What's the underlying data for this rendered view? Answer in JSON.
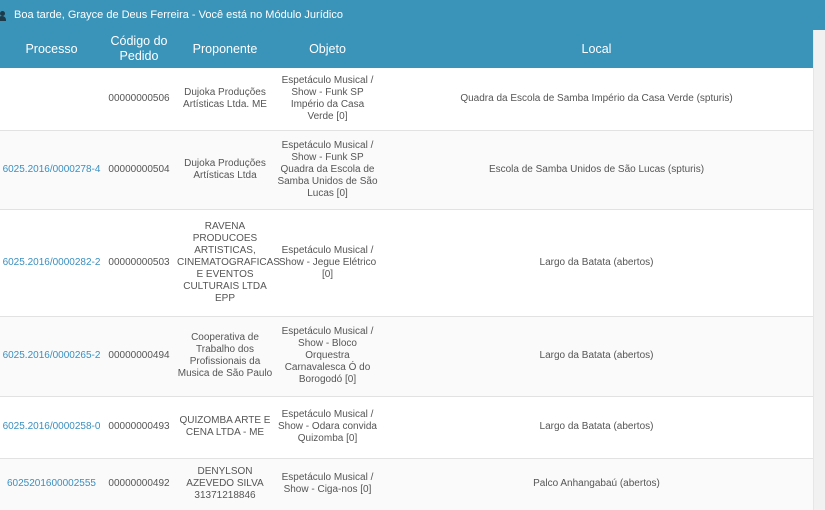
{
  "header": {
    "greeting": "Boa tarde, Grayce de Deus Ferreira - Você está no Módulo Jurídico"
  },
  "table": {
    "columns": [
      "Processo",
      "Código do Pedido",
      "Proponente",
      "Objeto",
      "Local"
    ],
    "rows": [
      {
        "processo": "",
        "codigo": "00000000506",
        "proponente": "Dujoka Produções Artísticas Ltda. ME",
        "objeto": "Espetáculo Musical / Show - Funk SP Império da Casa Verde [0]",
        "local": "Quadra da Escola de Samba Império da Casa Verde (spturis)"
      },
      {
        "processo": "6025.2016/0000278-4",
        "codigo": "00000000504",
        "proponente": "Dujoka Produções Artísticas Ltda",
        "objeto": "Espetáculo Musical / Show - Funk SP Quadra da Escola de Samba Unidos de São Lucas [0]",
        "local": "Escola de Samba Unidos de São Lucas (spturis)"
      },
      {
        "processo": "6025.2016/0000282-2",
        "codigo": "00000000503",
        "proponente": "RAVENA PRODUCOES ARTISTICAS, CINEMATOGRAFICAS E EVENTOS CULTURAIS LTDA EPP",
        "objeto": "Espetáculo Musical / Show - Jegue Elétrico [0]",
        "local": "Largo da Batata (abertos)"
      },
      {
        "processo": "6025.2016/0000265-2",
        "codigo": "00000000494",
        "proponente": "Cooperativa de Trabalho dos Profissionais da Musica de São Paulo",
        "objeto": "Espetáculo Musical / Show - Bloco Orquestra Carnavalesca Ó do Borogodó [0]",
        "local": "Largo da Batata (abertos)"
      },
      {
        "processo": "6025.2016/0000258-0",
        "codigo": "00000000493",
        "proponente": "QUIZOMBA ARTE E CENA LTDA - ME",
        "objeto": "Espetáculo Musical / Show - Odara convida Quizomba [0]",
        "local": "Largo da Batata (abertos)"
      },
      {
        "processo": "6025201600002555",
        "codigo": "00000000492",
        "proponente": "DENYLSON AZEVEDO SILVA 31371218846",
        "objeto": "Espetáculo Musical / Show - Ciga-nos [0]",
        "local": "Palco Anhangabaú (abertos)"
      }
    ]
  },
  "colors": {
    "header_bg": "#3a93b9",
    "link": "#3a8fc0",
    "text": "#555555"
  }
}
